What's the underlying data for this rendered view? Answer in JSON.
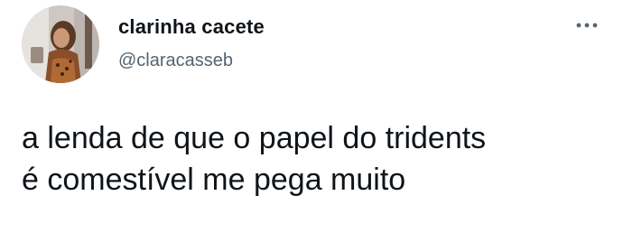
{
  "tweet": {
    "author": {
      "display_name": "clarinha cacete",
      "handle": "@claracasseb",
      "avatar_icon": "profile-photo"
    },
    "more_icon": "more-options-icon",
    "text_lines": [
      "a lenda de que o papel do tridents",
      "é comestível me pega muito"
    ]
  },
  "colors": {
    "text_primary": "#0f1419",
    "text_secondary": "#536471",
    "background": "#ffffff"
  }
}
